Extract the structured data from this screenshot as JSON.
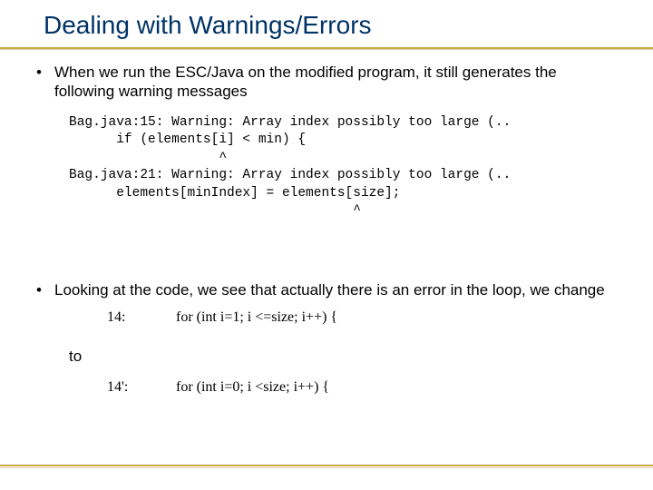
{
  "title": "Dealing with Warnings/Errors",
  "bullet1": "When we run the ESC/Java on the modified program, it still generates the following warning messages",
  "code": "Bag.java:15: Warning: Array index possibly too large (..\n      if (elements[i] < min) {\n                   ^\nBag.java:21: Warning: Array index possibly too large (..\n      elements[minIndex] = elements[size];\n                                    ^",
  "bullet2": "Looking at the code, we see that actually there is an error in the loop, we change",
  "toLabel": "to",
  "change": {
    "before": {
      "label": "14:",
      "code": "for (int i=1; i <=size; i++) {"
    },
    "after": {
      "label": "14':",
      "code": "for (int i=0; i <size; i++) {"
    }
  }
}
